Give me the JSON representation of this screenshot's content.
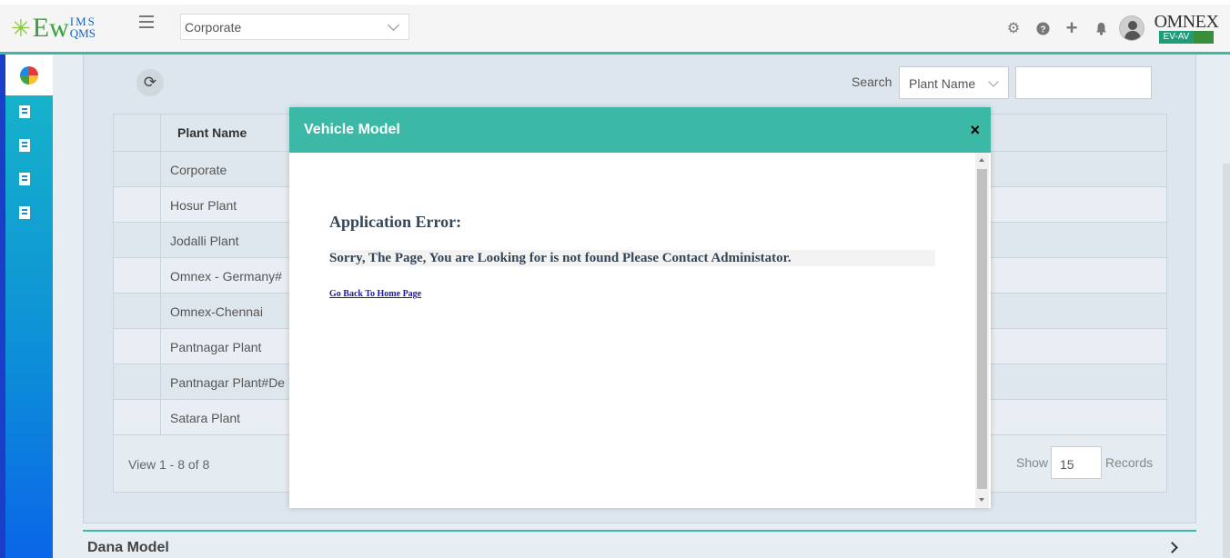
{
  "header": {
    "logo": {
      "main": "Ew",
      "sup": "IMS",
      "sub": "QMS"
    },
    "plant_select": "Corporate",
    "brand": {
      "name": "OMNEX",
      "badge": "EV-AV"
    },
    "icons": [
      "gear-icon",
      "help-icon",
      "plus-icon",
      "bell-icon",
      "user-avatar-icon"
    ]
  },
  "sidebar": {
    "items": [
      "building-icon",
      "building-icon",
      "building-icon",
      "building-icon"
    ]
  },
  "toolbar": {
    "search_label": "Search",
    "search_field": "Plant Name",
    "search_value": ""
  },
  "grid": {
    "column_header": "Plant Name",
    "rows": [
      "Corporate",
      "Hosur Plant",
      "Jodalli Plant",
      "Omnex - Germany#",
      "Omnex-Chennai",
      "Pantnagar Plant",
      "Pantnagar Plant#De",
      "Satara Plant"
    ],
    "view_info": "View 1 - 8 of 8",
    "show_label": "Show",
    "page_size": "15",
    "records_label": "Records"
  },
  "modal": {
    "title": "Vehicle Model",
    "close": "×",
    "error_title": "Application Error:",
    "error_message": "Sorry, The Page, You are Looking for is not found Please Contact Administator.",
    "home_link": "Go Back To Home Page"
  },
  "section": {
    "title": "Dana Model"
  },
  "colors": {
    "accent": "#3bb8a6",
    "sidebar_top": "#17b8c8",
    "sidebar_bottom": "#0a66e8"
  }
}
